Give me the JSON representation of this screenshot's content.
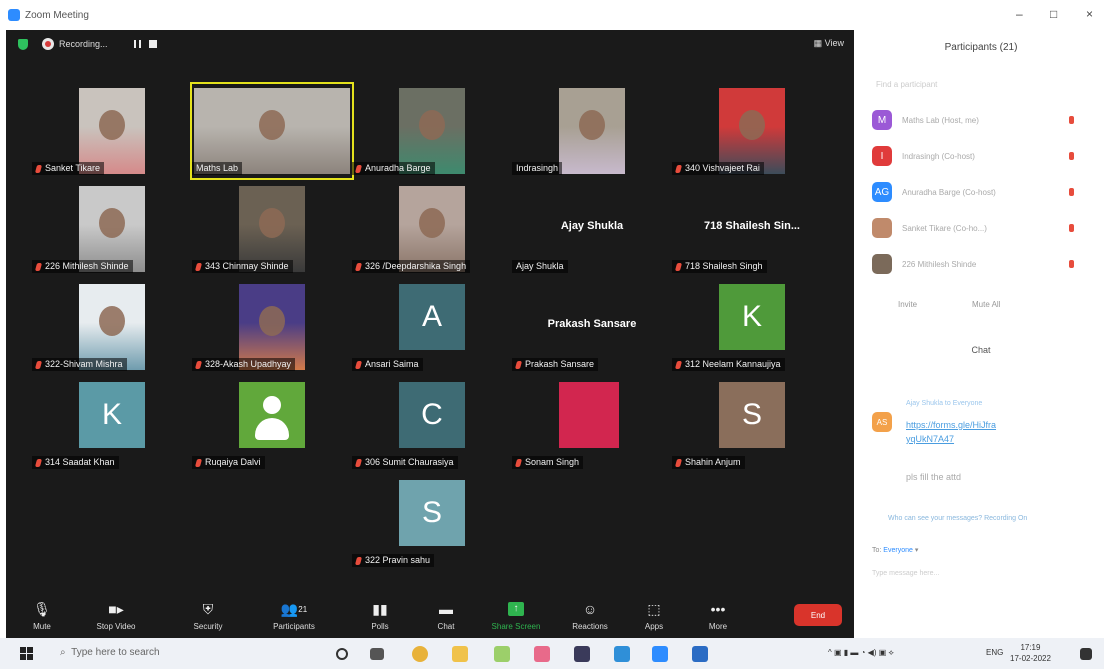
{
  "window": {
    "title": "Zoom Meeting",
    "controls": [
      "–",
      "□",
      "×"
    ]
  },
  "topbar": {
    "recording_label": "Recording...",
    "view_label": "View"
  },
  "tiles": [
    {
      "name": "Sanket Tikare",
      "kind": "photo",
      "photo_colors": [
        "#c9c3bd",
        "#d58a8a"
      ],
      "muted": true
    },
    {
      "name": "Maths Lab",
      "kind": "photo",
      "photo_colors": [
        "#b8b4ae",
        "#8c837c"
      ],
      "muted": false,
      "speaking": true
    },
    {
      "name": "Anuradha Barge",
      "kind": "photo",
      "photo_colors": [
        "#6b6f63",
        "#3e8a6e"
      ],
      "muted": true
    },
    {
      "name": "Indrasingh",
      "kind": "photo",
      "photo_colors": [
        "#a8a093",
        "#c7b9cc"
      ],
      "muted": false
    },
    {
      "name": "340 Vishvajeet Rai",
      "kind": "photo",
      "photo_colors": [
        "#d03a3a",
        "#3c4c5a"
      ],
      "muted": true
    },
    {
      "name": "226 Mithilesh Shinde",
      "kind": "photo",
      "photo_colors": [
        "#c9c9c9",
        "#8e8e8e"
      ],
      "muted": true
    },
    {
      "name": "343 Chinmay Shinde",
      "kind": "photo",
      "photo_colors": [
        "#6b6153",
        "#3a3a3a"
      ],
      "muted": true
    },
    {
      "name": "326 /Deepdarshika Singh",
      "kind": "photo",
      "photo_colors": [
        "#b5a49c",
        "#8a7568"
      ],
      "muted": true
    },
    {
      "name": "Ajay Shukla",
      "kind": "text",
      "big": "Ajay Shukla",
      "muted": false
    },
    {
      "name": "718 Shailesh Singh",
      "kind": "text",
      "big": "718 Shailesh Sin...",
      "muted": true
    },
    {
      "name": "322-Shivam Mishra",
      "kind": "photo",
      "photo_colors": [
        "#e7ecef",
        "#6f9cae"
      ],
      "muted": true
    },
    {
      "name": "328-Akash Upadhyay",
      "kind": "photo",
      "photo_colors": [
        "#4a3d86",
        "#d27a4a"
      ],
      "muted": true
    },
    {
      "name": "Ansari Saima",
      "kind": "avatar",
      "letter": "A",
      "color": "#3e6b74",
      "muted": true
    },
    {
      "name": "Prakash Sansare",
      "kind": "text",
      "big": "Prakash Sansare",
      "muted": true
    },
    {
      "name": "312 Neelam Kannaujiya",
      "kind": "avatar",
      "letter": "K",
      "color": "#4f9a3a",
      "muted": true
    },
    {
      "name": "314 Saadat Khan",
      "kind": "avatar",
      "letter": "K",
      "color": "#5b9aa6",
      "muted": true
    },
    {
      "name": "Ruqaiya Dalvi",
      "kind": "person",
      "color": "#61a83b",
      "muted": true
    },
    {
      "name": "306 Sumit Chaurasiya",
      "kind": "avatar",
      "letter": "C",
      "color": "#3e6b74",
      "muted": true
    },
    {
      "name": "Sonam Singh",
      "kind": "solid",
      "color": "#d2264f",
      "muted": true
    },
    {
      "name": "Shahin Anjum",
      "kind": "avatar",
      "letter": "S",
      "color": "#8a6e5b",
      "muted": true
    },
    {
      "name": "322 Pravin sahu",
      "kind": "avatar",
      "letter": "S",
      "color": "#6fa3ad",
      "muted": true
    }
  ],
  "toolbar": {
    "mute": "Mute",
    "stop_video": "Stop Video",
    "security": "Security",
    "participants": "Participants",
    "participants_count": "21",
    "polls": "Polls",
    "chat": "Chat",
    "share_screen": "Share Screen",
    "reactions": "Reactions",
    "apps": "Apps",
    "more": "More",
    "end": "End"
  },
  "panel": {
    "title": "Participants (21)",
    "search_placeholder": "Find a participant",
    "participants": [
      {
        "initial": "M",
        "color": "#9b59d6",
        "label": "Maths Lab (Host, me)"
      },
      {
        "initial": "I",
        "color": "#e03b3b",
        "label": "Indrasingh (Co-host)"
      },
      {
        "initial": "AG",
        "color": "#2d8cff",
        "label": "Anuradha Barge (Co-host)"
      },
      {
        "initial": "",
        "color": "#c08a6b",
        "label": "Sanket Tikare (Co-ho...)"
      },
      {
        "initial": "",
        "color": "#7b6a5a",
        "label": "226 Mithilesh Shinde"
      }
    ],
    "invite": "Invite",
    "mute_all": "Mute All",
    "chat_title": "Chat",
    "chat_sender": "Ajay Shukla  to  Everyone",
    "chat_avatar": "AS",
    "chat_link": "https://forms.gle/HiJfra yqUkN7A47",
    "chat_message": "pls fill the attd",
    "chat_note": "Who can see your messages? Recording On",
    "to_label": "To:",
    "to_value": "Everyone",
    "chat_input_placeholder": "Type message here..."
  },
  "taskbar": {
    "search_placeholder": "Type here to search",
    "lang": "ENG",
    "time": "17:19",
    "date": "17-02-2022"
  }
}
